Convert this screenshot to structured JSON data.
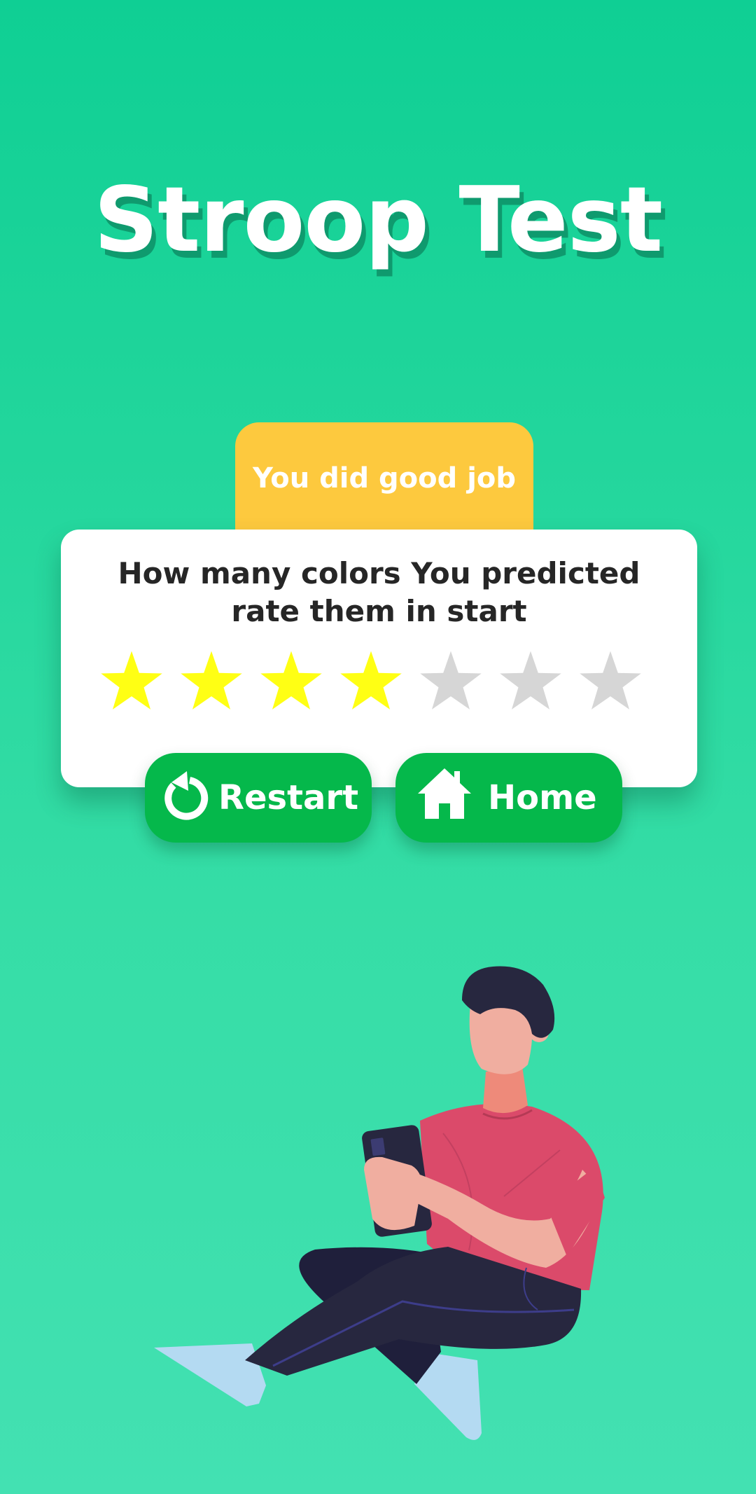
{
  "app": {
    "title": "Stroop Test"
  },
  "result": {
    "tab_label": "You did good job",
    "question": "How many colors You predicted rate them in start",
    "rating": {
      "filled": 4,
      "total": 7,
      "filled_color": "#ffff14",
      "empty_color": "#d6d6d6"
    }
  },
  "actions": {
    "restart_label": "Restart",
    "restart_icon": "restart-icon",
    "home_label": "Home",
    "home_icon": "home-icon"
  },
  "theme": {
    "background_top": "#0fcf94",
    "background_bottom": "#43e1b2",
    "tab_color": "#fdc93e",
    "button_color": "#05b84b",
    "title_shadow": "#0f9a6e"
  }
}
